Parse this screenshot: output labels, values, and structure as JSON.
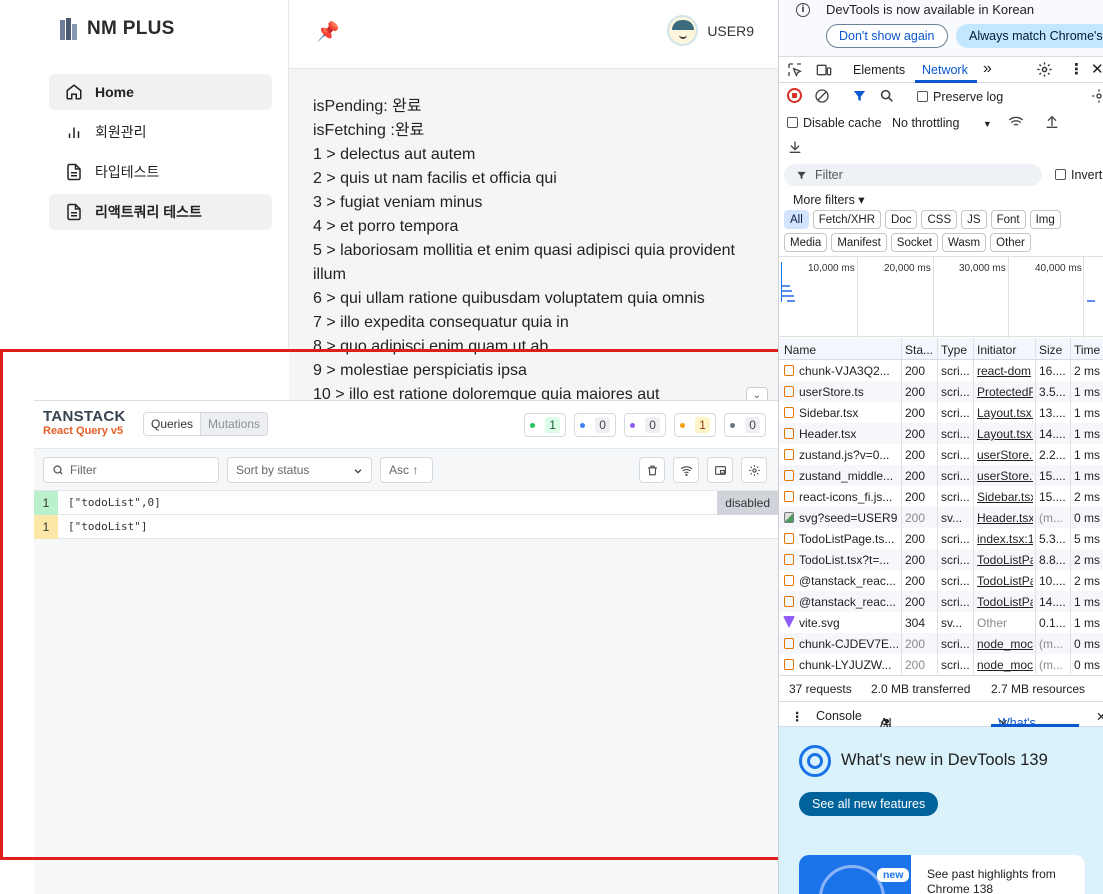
{
  "app": {
    "logo_text": "NM PLUS",
    "nav": [
      {
        "label": "Home",
        "icon": "home-icon",
        "active": true
      },
      {
        "label": "회원관리",
        "icon": "bar-chart-icon",
        "active": false
      },
      {
        "label": "타입테스트",
        "icon": "document-icon",
        "active": false
      },
      {
        "label": "리액트쿼리 테스트",
        "icon": "document-icon",
        "active": true
      }
    ],
    "header": {
      "pin_icon": "📌",
      "username": "USER9"
    },
    "content": {
      "lines": [
        "isPending: 완료",
        "isFetching :완료",
        "1 > delectus aut autem",
        "2 > quis ut nam facilis et officia qui",
        "3 > fugiat veniam minus",
        "4 > et porro tempora",
        "5 > laboriosam mollitia et enim quasi adipisci quia provident illum",
        "6 > qui ullam ratione quibusdam voluptatem quia omnis",
        "7 > illo expedita consequatur quia in",
        "8 > quo adipisci enim quam ut ab",
        "9 > molestiae perspiciatis ipsa",
        "10 > illo est ratione doloremque quia maiores aut"
      ],
      "collapse_glyph": "⌄"
    }
  },
  "tanstack": {
    "brand_top": "TANSTACK",
    "brand_bottom": "React Query v5",
    "tabs": [
      "Queries",
      "Mutations"
    ],
    "counts": [
      {
        "value": "1",
        "color": "#22c55e",
        "bg": "#dcfce7"
      },
      {
        "value": "0",
        "color": "#3b82f6",
        "bg": "#eef0f3"
      },
      {
        "value": "0",
        "color": "#8b5cf6",
        "bg": "#eef0f3"
      },
      {
        "value": "1",
        "color": "#f59e0b",
        "bg": "#fef3c7"
      },
      {
        "value": "0",
        "color": "#6b7280",
        "bg": "#eef0f3"
      }
    ],
    "filter_placeholder": "Filter",
    "sort_label": "Sort by status",
    "order_label": "Asc ↑",
    "queries": [
      {
        "count": "1",
        "key": "[\"todoList\",0]",
        "status": "disabled",
        "color": "#bbf0cc"
      },
      {
        "count": "1",
        "key": "[\"todoList\"]",
        "status": "",
        "color": "#fde7a8"
      }
    ]
  },
  "devtools": {
    "banner_message": "DevTools is now available in Korean",
    "dont_show": "Don't show again",
    "always_match": "Always match Chrome's l",
    "tabs": [
      "Elements",
      "Network"
    ],
    "more_tabs": "»",
    "preserve_log": "Preserve log",
    "disable_cache": "Disable cache",
    "throttling": "No throttling",
    "filter_placeholder": "Filter",
    "invert": "Invert",
    "more_filters": "More filters ▾",
    "chips": [
      "All",
      "Fetch/XHR",
      "Doc",
      "CSS",
      "JS",
      "Font",
      "Img",
      "Media",
      "Manifest",
      "Socket",
      "Wasm",
      "Other"
    ],
    "timeline": [
      "10,000 ms",
      "20,000 ms",
      "30,000 ms",
      "40,000 ms"
    ],
    "columns": [
      "Name",
      "Sta...",
      "Type",
      "Initiator",
      "Size",
      "Time"
    ],
    "rows": [
      {
        "name": "chunk-VJA3Q2...",
        "status": "200",
        "type": "scri...",
        "initiator": "react-dom",
        "size": "16....",
        "time": "2 ms",
        "icon": "script"
      },
      {
        "name": "userStore.ts",
        "status": "200",
        "type": "scri...",
        "initiator": "ProtectedR",
        "size": "3.5...",
        "time": "1 ms",
        "icon": "script"
      },
      {
        "name": "Sidebar.tsx",
        "status": "200",
        "type": "scri...",
        "initiator": "Layout.tsx:",
        "size": "13....",
        "time": "1 ms",
        "icon": "script"
      },
      {
        "name": "Header.tsx",
        "status": "200",
        "type": "scri...",
        "initiator": "Layout.tsx:",
        "size": "14....",
        "time": "1 ms",
        "icon": "script"
      },
      {
        "name": "zustand.js?v=0...",
        "status": "200",
        "type": "scri...",
        "initiator": "userStore.t",
        "size": "2.2...",
        "time": "1 ms",
        "icon": "script"
      },
      {
        "name": "zustand_middle...",
        "status": "200",
        "type": "scri...",
        "initiator": "userStore.t",
        "size": "15....",
        "time": "1 ms",
        "icon": "script"
      },
      {
        "name": "react-icons_fi.js...",
        "status": "200",
        "type": "scri...",
        "initiator": "Sidebar.tsx",
        "size": "15....",
        "time": "2 ms",
        "icon": "script"
      },
      {
        "name": "svg?seed=USER9",
        "status": "200",
        "type": "sv...",
        "initiator": "Header.tsx",
        "size": "(m...",
        "time": "0 ms",
        "icon": "img",
        "muted": true
      },
      {
        "name": "TodoListPage.ts...",
        "status": "200",
        "type": "scri...",
        "initiator": "index.tsx:1",
        "size": "5.3...",
        "time": "5 ms",
        "icon": "script"
      },
      {
        "name": "TodoList.tsx?t=...",
        "status": "200",
        "type": "scri...",
        "initiator": "TodoListPa",
        "size": "8.8...",
        "time": "2 ms",
        "icon": "script"
      },
      {
        "name": "@tanstack_reac...",
        "status": "200",
        "type": "scri...",
        "initiator": "TodoListPa",
        "size": "10....",
        "time": "2 ms",
        "icon": "script"
      },
      {
        "name": "@tanstack_reac...",
        "status": "200",
        "type": "scri...",
        "initiator": "TodoListPa",
        "size": "14....",
        "time": "1 ms",
        "icon": "script"
      },
      {
        "name": "vite.svg",
        "status": "304",
        "type": "sv...",
        "initiator": "Other",
        "size": "0.1...",
        "time": "1 ms",
        "icon": "vite",
        "plain_initiator": true
      },
      {
        "name": "chunk-CJDEV7E...",
        "status": "200",
        "type": "scri...",
        "initiator": "node_moc",
        "size": "(m...",
        "time": "0 ms",
        "icon": "script",
        "muted": true
      },
      {
        "name": "chunk-LYJUZW...",
        "status": "200",
        "type": "scri...",
        "initiator": "node_moc",
        "size": "(m...",
        "time": "0 ms",
        "icon": "script",
        "muted": true
      }
    ],
    "summary": [
      "37 requests",
      "2.0 MB transferred",
      "2.7 MB resources"
    ],
    "drawer_tabs": [
      "Console",
      "AI assistance",
      "What's new"
    ],
    "whats_new_title": "What's new in DevTools 139",
    "see_all": "See all new features",
    "card_badge": "new",
    "card_text": "See past highlights from Chrome 138"
  }
}
